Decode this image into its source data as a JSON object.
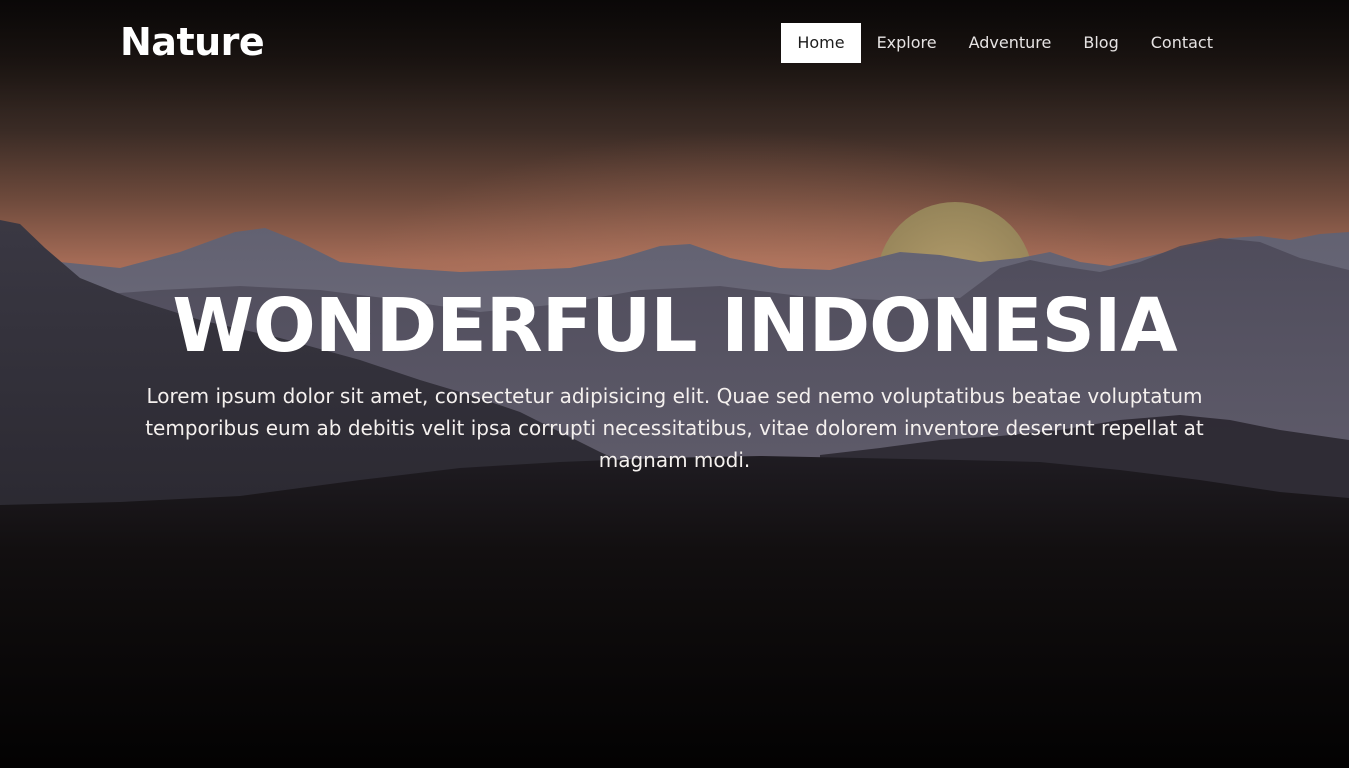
{
  "header": {
    "logo": "Nature",
    "nav": [
      {
        "label": "Home",
        "active": true
      },
      {
        "label": "Explore",
        "active": false
      },
      {
        "label": "Adventure",
        "active": false
      },
      {
        "label": "Blog",
        "active": false
      },
      {
        "label": "Contact",
        "active": false
      }
    ]
  },
  "hero": {
    "title": "WONDERFUL INDONESIA",
    "text": "Lorem ipsum dolor sit amet, consectetur adipisicing elit. Quae sed nemo voluptatibus beatae voluptatum temporibus eum ab debitis velit ipsa corrupti necessitatibus, vitae dolorem inventore deserunt repellat at magnam modi."
  },
  "colors": {
    "sky_top": "#17120f",
    "sky_glow": "#b8755c",
    "sun": "#a89968",
    "foreground": "#050404"
  }
}
